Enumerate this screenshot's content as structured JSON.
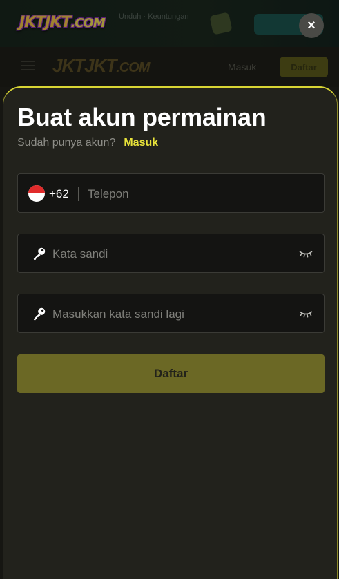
{
  "background": {
    "logo_text": "JKTJKT",
    "logo_suffix": ".COM",
    "top_text": "Unduh · Keuntungan",
    "nav_login": "Masuk",
    "nav_register": "Daftar"
  },
  "modal": {
    "close_label": "×",
    "title": "Buat akun permainan",
    "subtitle": "Sudah punya akun?",
    "login_link": "Masuk",
    "phone": {
      "country_flag": "indonesia-flag",
      "dial_code": "+62",
      "placeholder": "Telepon"
    },
    "password": {
      "placeholder": "Kata sandi",
      "icon": "key-icon",
      "toggle_icon": "eye-closed-icon"
    },
    "confirm_password": {
      "placeholder": "Masukkan kata sandi lagi",
      "icon": "key-icon",
      "toggle_icon": "eye-closed-icon"
    },
    "submit_label": "Daftar"
  },
  "colors": {
    "accent": "#e8e33a",
    "button": "#6b6825",
    "sheet": "#22221c",
    "field": "#141412"
  }
}
